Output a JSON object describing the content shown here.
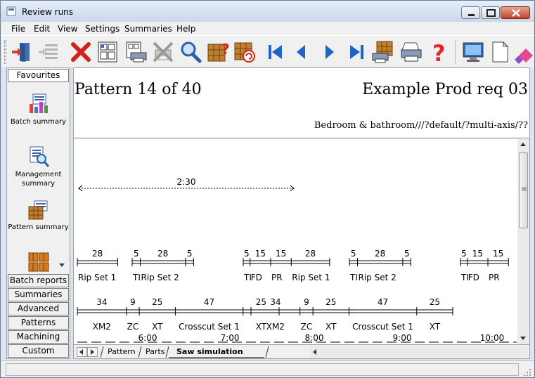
{
  "window": {
    "title": "Review runs",
    "icons": {
      "app": "app-icon",
      "minimize": "minimize-icon",
      "maximize": "maximize-icon",
      "close": "close-icon"
    }
  },
  "menu": [
    "File",
    "Edit",
    "View",
    "Settings",
    "Summaries",
    "Help"
  ],
  "toolbar": {
    "icons": [
      "open-door-icon",
      "list-icon",
      "delete-x-icon",
      "pattern-grid-icon",
      "pattern-print-icon",
      "cancel-print-icon",
      "search-icon",
      "grid-question-icon",
      "grid-refresh-icon",
      "first-icon",
      "previous-icon",
      "next-icon",
      "last-icon",
      "print-preview-icon",
      "printer-icon",
      "help-icon",
      "monitor-icon",
      "blank-page-icon",
      "eraser-icon"
    ]
  },
  "sidebar": {
    "header": "Favourites",
    "items": [
      {
        "label": "Batch summary",
        "icon": "batch-summary-icon"
      },
      {
        "label": "Management summary",
        "icon": "management-summary-icon"
      },
      {
        "label": "Pattern summary",
        "icon": "pattern-summary-icon"
      },
      {
        "label": "",
        "icon": "boxes-icon"
      }
    ],
    "tabs": [
      "Batch reports",
      "Summaries",
      "Advanced",
      "Patterns",
      "Machining",
      "Custom"
    ]
  },
  "main": {
    "pattern_title": "Pattern 14 of 40",
    "prod_title": "Example Prod req 03",
    "subtitle": "Bedroom & bathroom///?default/?multi-axis/??",
    "scale_label": "2:30",
    "row1": [
      {
        "v": "28",
        "l": "Rip Set 1"
      },
      {
        "v": "5",
        "l": "TI"
      },
      {
        "v": "28",
        "l": "Rip Set 2"
      },
      {
        "v": "5",
        "l": ""
      },
      {
        "v": "5",
        "l": "TI"
      },
      {
        "v": "15",
        "l": "FD"
      },
      {
        "v": "15",
        "l": "PR"
      },
      {
        "v": "28",
        "l": "Rip Set 1"
      },
      {
        "v": "5",
        "l": "TI"
      },
      {
        "v": "28",
        "l": "Rip Set 2"
      },
      {
        "v": "5",
        "l": ""
      },
      {
        "v": "5",
        "l": "TI"
      },
      {
        "v": "15",
        "l": "FD"
      },
      {
        "v": "15",
        "l": "PR"
      }
    ],
    "row2": [
      {
        "v": "34",
        "l": "XM2"
      },
      {
        "v": "9",
        "l": "ZC"
      },
      {
        "v": "25",
        "l": "XT"
      },
      {
        "v": "47",
        "l": "Crosscut Set 1"
      },
      {
        "v": "25",
        "l": "XT"
      },
      {
        "v": "34",
        "l": "XM2"
      },
      {
        "v": "9",
        "l": "ZC"
      },
      {
        "v": "25",
        "l": "XT"
      },
      {
        "v": "47",
        "l": "Crosscut Set 1"
      },
      {
        "v": "25",
        "l": "XT"
      }
    ],
    "times": [
      "6:00",
      "7:00",
      "8:00",
      "9:00",
      "10:00"
    ]
  },
  "tabs": [
    "Pattern",
    "Parts",
    "Saw simulation"
  ]
}
